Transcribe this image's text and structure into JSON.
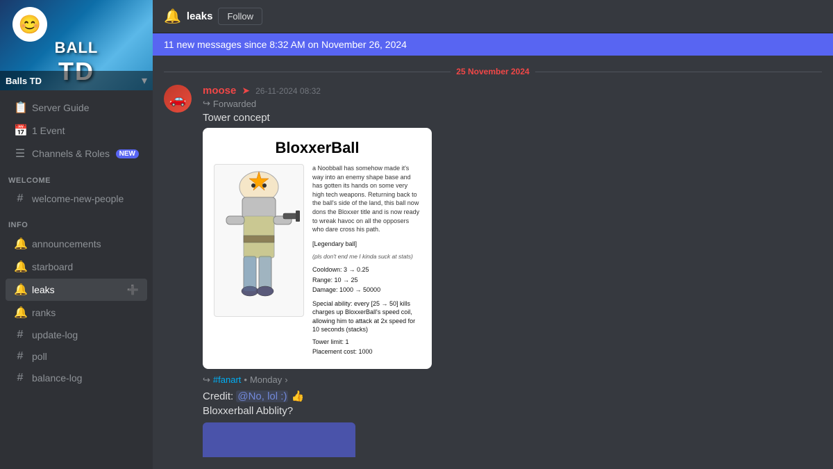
{
  "server": {
    "name": "Balls TD",
    "logo_emoji": "😊",
    "logo_lines": [
      "BALL",
      "TD"
    ]
  },
  "sidebar": {
    "special_items": [
      {
        "id": "server-guide",
        "icon": "📋",
        "label": "Server Guide"
      },
      {
        "id": "event",
        "icon": "📅",
        "label": "1 Event"
      },
      {
        "id": "channels-roles",
        "icon": "☰",
        "label": "Channels & Roles",
        "badge": "NEW"
      }
    ],
    "sections": [
      {
        "label": "WELCOME",
        "channels": [
          {
            "id": "welcome-new-people",
            "type": "hash",
            "label": "welcome-new-people",
            "active": false
          }
        ]
      },
      {
        "label": "INFO",
        "channels": [
          {
            "id": "announcements",
            "type": "speaker",
            "label": "announcements",
            "active": false
          },
          {
            "id": "starboard",
            "type": "speaker",
            "label": "starboard",
            "active": false
          },
          {
            "id": "leaks",
            "type": "speaker",
            "label": "leaks",
            "active": true
          },
          {
            "id": "ranks",
            "type": "speaker",
            "label": "ranks",
            "active": false
          },
          {
            "id": "update-log",
            "type": "hash",
            "label": "update-log",
            "active": false
          },
          {
            "id": "poll",
            "type": "hash",
            "label": "poll",
            "active": false
          },
          {
            "id": "balance-log",
            "type": "hash",
            "label": "balance-log",
            "active": false
          }
        ]
      }
    ]
  },
  "channel_header": {
    "icon": "🔊",
    "name": "leaks",
    "follow_label": "Follow"
  },
  "banner": {
    "text": "11 new messages since 8:32 AM on November 26, 2024"
  },
  "date_divider": {
    "text": "25 November 2024"
  },
  "message": {
    "author": "moose",
    "author_arrow": "➤",
    "timestamp": "26-11-2024 08:32",
    "forwarded_label": "Forwarded",
    "tower_concept_label": "Tower concept",
    "card": {
      "title": "BloxxerBall",
      "description": "a Noobball has somehow made it's way into an enemy shape base and has gotten its hands on some very high tech weapons. Returning back to the ball's side of the land, this ball now dons the Bloxxer title and is now ready to wreak havoc on all the opposers who dare cross his path.",
      "tag": "[Legendary ball]",
      "italic_note": "(pls don't end me I kinda suck at stats)",
      "cooldown": "Cooldown: 3 → 0.25",
      "range": "Range: 10 → 25",
      "damage": "Damage: 1000 → 50000",
      "special": "Special ability: every [25 → 50] kills charges up BloxxerBall's speed coil, allowing him to attack at 2x speed for 10 seconds (stacks)",
      "tower_limit": "Tower limit: 1",
      "placement_cost": "Placement cost: 1000"
    },
    "source_channel": "#fanart",
    "source_day": "Monday",
    "credit_text": "Credit:",
    "mention": "@No, lol :)",
    "thumbs_up": "👍",
    "question": "Bloxxerball Abblity?"
  },
  "add_member_icon": "➕"
}
